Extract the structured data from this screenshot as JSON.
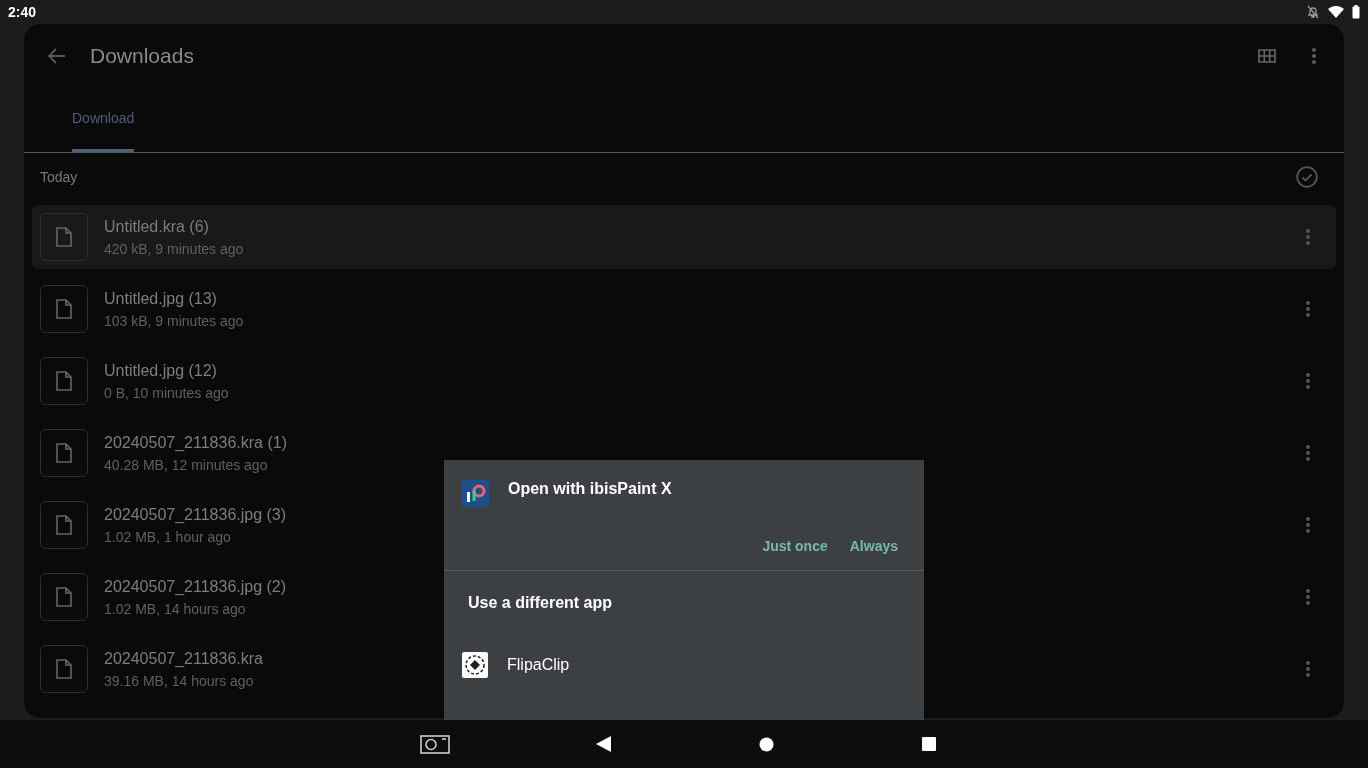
{
  "status_bar": {
    "time": "2:40"
  },
  "app_bar": {
    "title": "Downloads"
  },
  "tabs": [
    {
      "label": "Download",
      "selected": true
    }
  ],
  "section": {
    "title": "Today"
  },
  "files": [
    {
      "name": "Untitled.kra (6)",
      "details": "420 kB, 9 minutes ago",
      "selected": true
    },
    {
      "name": "Untitled.jpg (13)",
      "details": "103 kB, 9 minutes ago",
      "selected": false
    },
    {
      "name": "Untitled.jpg (12)",
      "details": "0 B, 10 minutes ago",
      "selected": false
    },
    {
      "name": "20240507_211836.kra (1)",
      "details": "40.28 MB, 12 minutes ago",
      "selected": false
    },
    {
      "name": "20240507_211836.jpg (3)",
      "details": "1.02 MB, 1 hour ago",
      "selected": false
    },
    {
      "name": "20240507_211836.jpg (2)",
      "details": "1.02 MB, 14 hours ago",
      "selected": false
    },
    {
      "name": "20240507_211836.kra",
      "details": "39.16 MB, 14 hours ago",
      "selected": false
    }
  ],
  "dialog": {
    "title": "Open with ibisPaint X",
    "buttons": [
      "Just once",
      "Always"
    ],
    "other_heading": "Use a different app",
    "apps": [
      {
        "name": "FlipaClip"
      }
    ]
  }
}
